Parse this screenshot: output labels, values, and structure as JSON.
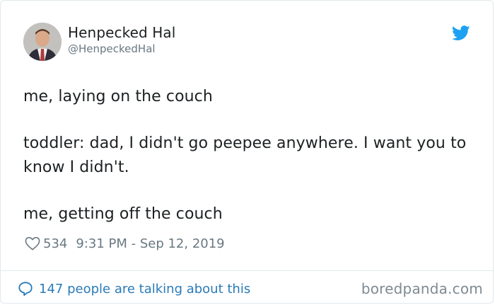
{
  "author": {
    "display_name": "Henpecked Hal",
    "handle": "@HenpeckedHal",
    "avatar_icon": "user-avatar"
  },
  "brand": {
    "icon": "twitter-bird-icon",
    "color": "#1da1f2"
  },
  "tweet": {
    "lines": [
      "me, laying on the couch",
      "toddler: dad, I didn't go peepee anywhere. I want you to know I didn't.",
      "me, getting off the couch"
    ],
    "like_count": "534",
    "timestamp": "9:31 PM - Sep 12, 2019"
  },
  "footer": {
    "conversation_label": "147 people are talking about this",
    "watermark": "boredpanda.com",
    "link_color": "#2b7bb9"
  }
}
